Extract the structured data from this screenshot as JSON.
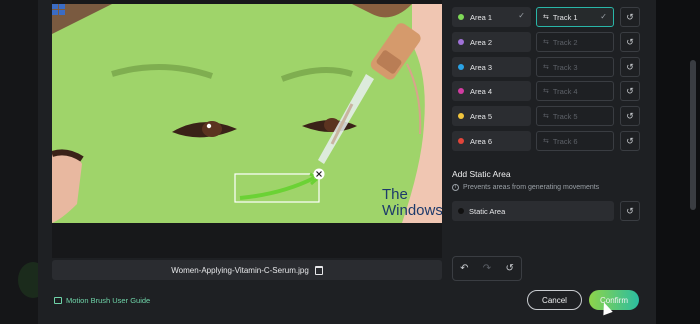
{
  "canvas": {
    "filename": "Women-Applying-Vitamin-C-Serum.jpg",
    "watermark_line1": "The",
    "watermark_line2": "WindowsClub"
  },
  "areas": [
    {
      "label": "Area 1",
      "color": "#7ed957",
      "checked": true
    },
    {
      "label": "Area 2",
      "color": "#a072d8",
      "checked": false
    },
    {
      "label": "Area 3",
      "color": "#2aa3e6",
      "checked": false
    },
    {
      "label": "Area 4",
      "color": "#d13ca1",
      "checked": false
    },
    {
      "label": "Area 5",
      "color": "#f2c53d",
      "checked": false
    },
    {
      "label": "Area 6",
      "color": "#e2453a",
      "checked": false
    }
  ],
  "tracks": [
    {
      "label": "Track 1",
      "active": true
    },
    {
      "label": "Track 2",
      "active": false
    },
    {
      "label": "Track 3",
      "active": false
    },
    {
      "label": "Track 4",
      "active": false
    },
    {
      "label": "Track 5",
      "active": false
    },
    {
      "label": "Track 6",
      "active": false
    }
  ],
  "static": {
    "title": "Add Static Area",
    "note": "Prevents areas from generating movements",
    "area_label": "Static Area"
  },
  "footer": {
    "guide_label": "Motion Brush User Guide",
    "cancel_label": "Cancel",
    "confirm_label": "Confirm"
  },
  "colors": {
    "accent_track": "#29b6a8",
    "mask_green": "#9fd46a",
    "guide_link": "#6fd3a8"
  }
}
